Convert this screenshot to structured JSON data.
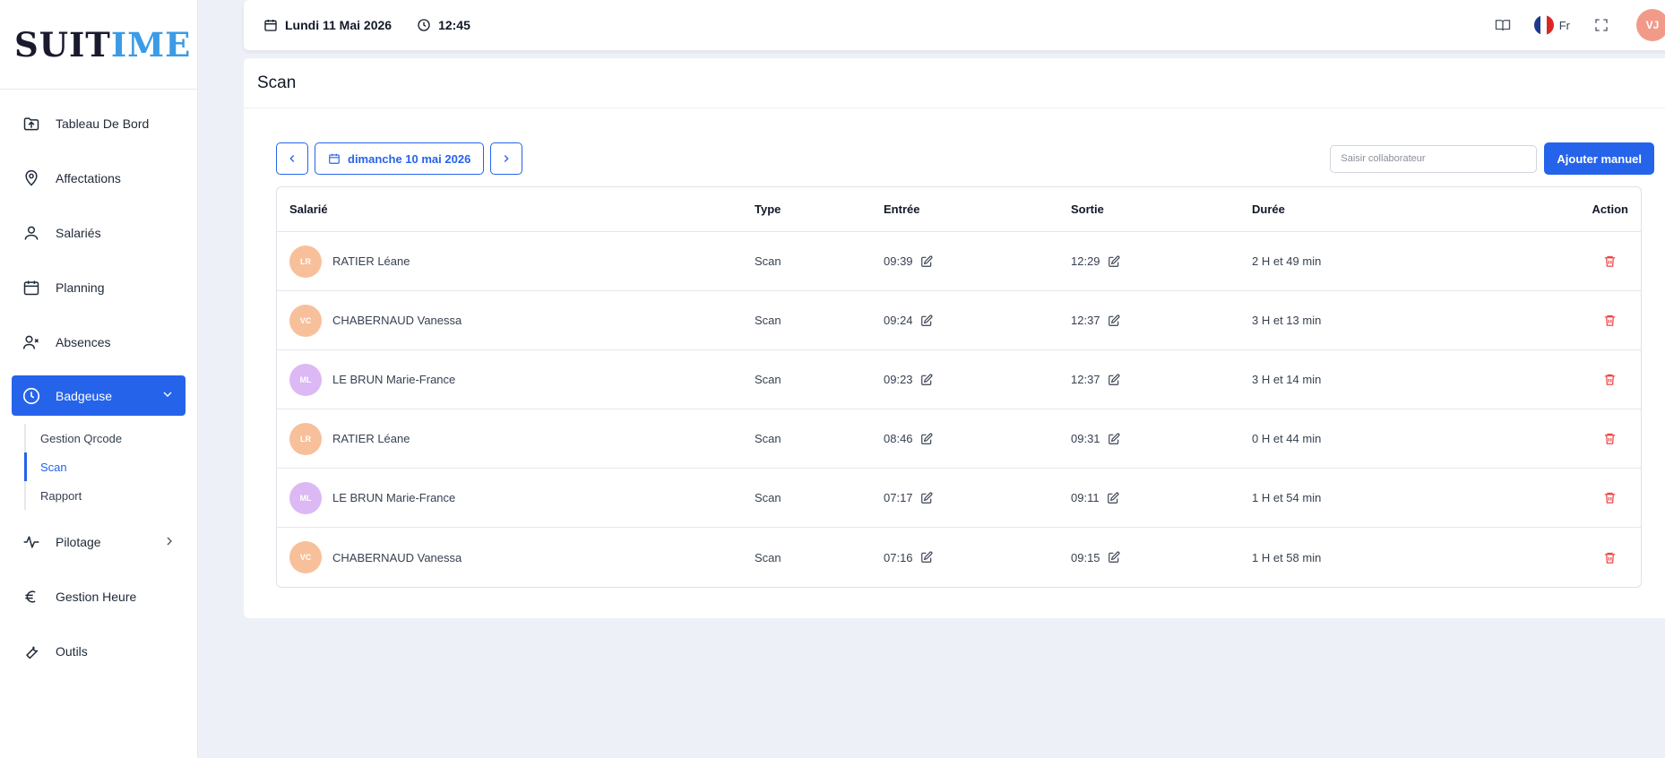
{
  "logo": {
    "part1": "SUIT",
    "part2": "I",
    "part3": "ME"
  },
  "sidebar": {
    "items": [
      {
        "label": "Tableau De Bord"
      },
      {
        "label": "Affectations"
      },
      {
        "label": "Salariés"
      },
      {
        "label": "Planning"
      },
      {
        "label": "Absences"
      },
      {
        "label": "Badgeuse"
      },
      {
        "label": "Pilotage"
      },
      {
        "label": "Gestion Heure"
      },
      {
        "label": "Outils"
      }
    ],
    "sub_items": [
      {
        "label": "Gestion Qrcode"
      },
      {
        "label": "Scan"
      },
      {
        "label": "Rapport"
      }
    ]
  },
  "topbar": {
    "date": "Lundi 11 Mai 2026",
    "time": "12:45",
    "language": "Fr",
    "user_initials": "VJ"
  },
  "page": {
    "title": "Scan",
    "date_selector": "dimanche 10 mai 2026",
    "search_placeholder": "Saisir collaborateur",
    "add_button": "Ajouter manuel"
  },
  "table": {
    "headers": {
      "employee": "Salarié",
      "type": "Type",
      "entry": "Entrée",
      "exit": "Sortie",
      "duration": "Durée",
      "action": "Action"
    },
    "rows": [
      {
        "initials": "LR",
        "avatar_color": "#f8c09a",
        "name": "RATIER Léane",
        "type": "Scan",
        "entry": "09:39",
        "exit": "12:29",
        "duration": "2 H et 49 min"
      },
      {
        "initials": "VC",
        "avatar_color": "#f8c09a",
        "name": "CHABERNAUD Vanessa",
        "type": "Scan",
        "entry": "09:24",
        "exit": "12:37",
        "duration": "3 H et 13 min"
      },
      {
        "initials": "ML",
        "avatar_color": "#dcb8f4",
        "name": "LE BRUN Marie-France",
        "type": "Scan",
        "entry": "09:23",
        "exit": "12:37",
        "duration": "3 H et 14 min"
      },
      {
        "initials": "LR",
        "avatar_color": "#f8c09a",
        "name": "RATIER Léane",
        "type": "Scan",
        "entry": "08:46",
        "exit": "09:31",
        "duration": "0 H et 44 min"
      },
      {
        "initials": "ML",
        "avatar_color": "#dcb8f4",
        "name": "LE BRUN Marie-France",
        "type": "Scan",
        "entry": "07:17",
        "exit": "09:11",
        "duration": "1 H et 54 min"
      },
      {
        "initials": "VC",
        "avatar_color": "#f8c09a",
        "name": "CHABERNAUD Vanessa",
        "type": "Scan",
        "entry": "07:16",
        "exit": "09:15",
        "duration": "1 H et 58 min"
      }
    ]
  },
  "colors": {
    "primary": "#2563eb",
    "danger": "#ef4444",
    "logo_accent": "#3b9be6"
  }
}
